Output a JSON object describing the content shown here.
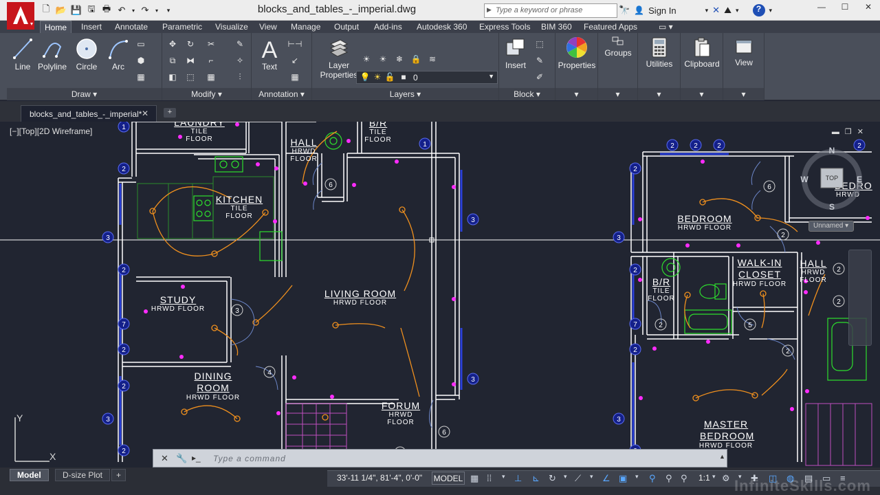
{
  "window": {
    "title": "blocks_and_tables_-_imperial.dwg",
    "search_placeholder": "Type a keyword or phrase",
    "sign_in": "Sign In",
    "controls": [
      "—",
      "☐",
      "✕"
    ]
  },
  "ribbon": {
    "tabs": [
      "Home",
      "Insert",
      "Annotate",
      "Parametric",
      "Visualize",
      "View",
      "Manage",
      "Output",
      "Add-ins",
      "Autodesk 360",
      "Express Tools",
      "BIM 360",
      "Featured Apps"
    ],
    "active_tab": "Home",
    "draw": {
      "title": "Draw",
      "tools": [
        "Line",
        "Polyline",
        "Circle",
        "Arc"
      ]
    },
    "modify": {
      "title": "Modify"
    },
    "annotation": {
      "title": "Annotation",
      "text_tool": "Text"
    },
    "layers": {
      "title": "Layers",
      "layer_properties": "Layer Properties",
      "current_layer": "0"
    },
    "block": {
      "title": "Block",
      "insert": "Insert"
    },
    "properties": "Properties",
    "groups": "Groups",
    "utilities": "Utilities",
    "clipboard": "Clipboard",
    "view": "View"
  },
  "file_tab": {
    "name": "blocks_and_tables_-_imperial*"
  },
  "viewport": {
    "label": "[−][Top][2D Wireframe]",
    "viewcube_top": "TOP",
    "compass": {
      "n": "N",
      "s": "S",
      "e": "E",
      "w": "W"
    },
    "ucs_name": "Unnamed",
    "ucs_y": "Y",
    "ucs_x": "X"
  },
  "rooms": [
    {
      "name": "LAUNDRY",
      "floor": [
        "TILE",
        "FLOOR"
      ]
    },
    {
      "name": "HALL",
      "floor": [
        "HRWD",
        "FLOOR"
      ]
    },
    {
      "name": "B/R",
      "floor": [
        "TILE",
        "FLOOR"
      ]
    },
    {
      "name": "KITCHEN",
      "floor": [
        "TILE",
        "FLOOR"
      ]
    },
    {
      "name": "STUDY",
      "floor": [
        "HRWD FLOOR"
      ]
    },
    {
      "name": "LIVING ROOM",
      "floor": [
        "HRWD FLOOR"
      ]
    },
    {
      "name": "DINING ROOM",
      "floor": [
        "HRWD FLOOR"
      ]
    },
    {
      "name": "FORUM",
      "floor": [
        "HRWD",
        "FLOOR"
      ]
    },
    {
      "name": "BEDROOM",
      "floor": [
        "HRWD FLOOR"
      ]
    },
    {
      "name": "B/R",
      "floor": [
        "TILE",
        "FLOOR"
      ]
    },
    {
      "name": "WALK-IN CLOSET",
      "floor": [
        "HRWD FLOOR"
      ]
    },
    {
      "name": "HALL",
      "floor": [
        "HRWD",
        "FLOOR"
      ]
    },
    {
      "name": "MASTER BEDROOM",
      "floor": [
        "HRWD FLOOR"
      ]
    },
    {
      "name": "BEDRO",
      "floor": [
        "HRWD"
      ]
    }
  ],
  "command_line": {
    "placeholder": "Type a command"
  },
  "status_bar": {
    "layout_tabs": [
      "Model",
      "D-size Plot"
    ],
    "coordinates": "33'-11 1/4\", 81'-4\", 0'-0\"",
    "space": "MODEL",
    "annotation_scale": "1:1"
  },
  "watermark": "InfiniteSkills.com",
  "colors": {
    "background": "#212531",
    "ribbon": "#4a4f5a",
    "walls": "#ffffff",
    "wiring": "#f0901e",
    "electrical": "#ff2cff",
    "fixtures": "#2de02d",
    "tags": "#2238c0"
  }
}
